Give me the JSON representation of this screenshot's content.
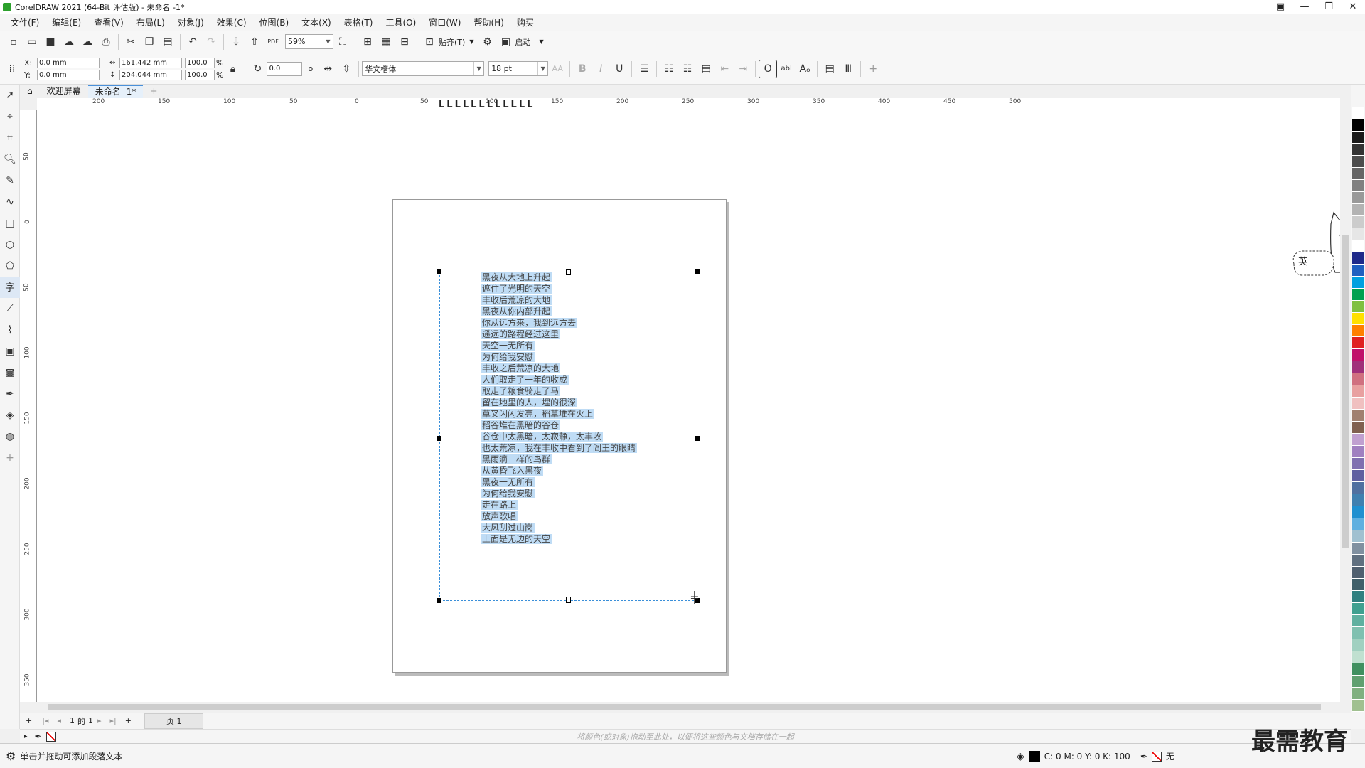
{
  "window": {
    "title": "CorelDRAW 2021 (64-Bit 评估版) - 未命名 -1*",
    "controls": [
      "▣",
      "—",
      "❐",
      "✕"
    ]
  },
  "menu": [
    "文件(F)",
    "编辑(E)",
    "查看(V)",
    "布局(L)",
    "对象(J)",
    "效果(C)",
    "位图(B)",
    "文本(X)",
    "表格(T)",
    "工具(O)",
    "窗口(W)",
    "帮助(H)",
    "购买"
  ],
  "toolbar1": {
    "zoom": "59%",
    "snap_label": "贴齐(T)",
    "launch_label": "启动",
    "pdf_label": "PDF"
  },
  "toolbar2": {
    "x_label": "X:",
    "y_label": "Y:",
    "x_value": "0.0 mm",
    "y_value": "0.0 mm",
    "width": "161.442 mm",
    "height": "204.044 mm",
    "scale_w": "100.0",
    "scale_h": "100.0",
    "pct": "%",
    "rotation": "0.0",
    "degree": "o",
    "font": "华文楷体",
    "font_size": "18 pt",
    "bold": "B",
    "italic": "I",
    "underline": "U",
    "aa": "AA",
    "abl": "abl",
    "plus": "+"
  },
  "tabs": [
    "欢迎屏幕",
    "未命名 -1*"
  ],
  "ruler": {
    "h_ticks": [
      "200",
      "150",
      "100",
      "50",
      "0",
      "50",
      "100",
      "150",
      "200",
      "250",
      "300",
      "350",
      "400",
      "450",
      "500"
    ],
    "v_ticks": [
      "50",
      "0",
      "50",
      "100",
      "150",
      "200",
      "250",
      "300",
      "350"
    ]
  },
  "poem": [
    "黑夜从大地上升起",
    "遮住了光明的天空",
    "丰收后荒凉的大地",
    "黑夜从你内部升起",
    "你从远方来，我到远方去",
    "遥远的路程经过这里",
    "天空一无所有",
    "为何给我安慰",
    "丰收之后荒凉的大地",
    "人们取走了一年的收成",
    "取走了粮食骑走了马",
    "留在地里的人，埋的很深",
    "草叉闪闪发亮，稻草堆在火上",
    "稻谷堆在黑暗的谷仓",
    "谷仓中太黑暗，太寂静，太丰收",
    "也太荒凉，我在丰收中看到了阎王的眼睛",
    "黑雨滴一样的鸟群",
    "从黄昏飞入黑夜",
    "黑夜一无所有",
    "为何给我安慰",
    "走在路上",
    "放声歌唱",
    "大风刮过山岗",
    "上面是无边的天空"
  ],
  "ime": {
    "label": "英"
  },
  "pagenav": {
    "current": "1",
    "of": "的",
    "total": "1",
    "page_tab": "页 1"
  },
  "docpalette_hint": "将颜色(或对象)拖动至此处，以便将这些颜色与文档存储在一起",
  "status": {
    "message": "单击并拖动可添加段落文本",
    "cmyk": "C: 0 M: 0 Y: 0 K: 100",
    "outline": "无"
  },
  "watermark": "最需教育",
  "palette": [
    "#ffffff",
    "#000000",
    "#1a1a1a",
    "#333333",
    "#4d4d4d",
    "#666666",
    "#808080",
    "#999999",
    "#b3b3b3",
    "#cccccc",
    "#e6e6e6",
    "#ffffff",
    "#1f2a8a",
    "#2060c0",
    "#00a0e0",
    "#00a050",
    "#80c040",
    "#ffe000",
    "#ff8000",
    "#e02020",
    "#c0106a",
    "#a0307a",
    "#d07080",
    "#e8a0a0",
    "#f0c0c0",
    "#a08070",
    "#806050",
    "#c0a0d0",
    "#a080c0",
    "#8070b0",
    "#6060a0",
    "#5070a0",
    "#4080b0",
    "#2090d0",
    "#60b0e0",
    "#a0c0d0",
    "#8090a0",
    "#607080",
    "#506070",
    "#40606a",
    "#308080",
    "#40a090",
    "#60b0a0",
    "#80c0b0",
    "#a0d0c0",
    "#c0e0d0",
    "#409060",
    "#60a070",
    "#80b080",
    "#a0c090"
  ]
}
